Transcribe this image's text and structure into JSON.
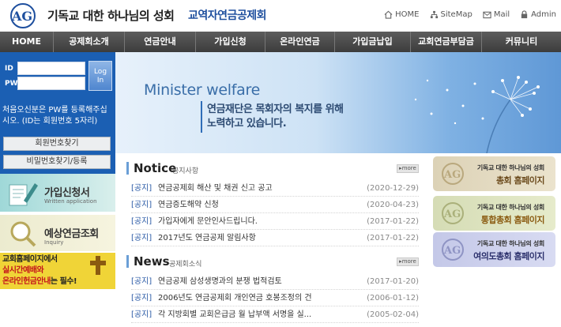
{
  "header": {
    "title": "기독교 대한 하나님의 성회",
    "subtitle": "교역자연금공제회",
    "logo_text": "AG",
    "links": [
      {
        "label": "HOME",
        "icon": "home-icon"
      },
      {
        "label": "SiteMap",
        "icon": "sitemap-icon"
      },
      {
        "label": "Mail",
        "icon": "mail-icon"
      },
      {
        "label": "Admin",
        "icon": "admin-icon"
      }
    ]
  },
  "nav": [
    "HOME",
    "공제회소개",
    "연금안내",
    "가입신청",
    "온라인연금",
    "가입금납입",
    "교회연금부담금",
    "커뮤니티"
  ],
  "login": {
    "id_label": "ID",
    "pw_label": "PW",
    "button_label_1": "Log",
    "button_label_2": "In",
    "notice": "처음오신분은 PW를 등록해주십시오. (ID는 회원번호 5자리)",
    "find_id": "회원번호찾기",
    "find_pw": "비밀번호찾기/등록"
  },
  "left_banners": {
    "apply_title": "가입신청서",
    "apply_sub": "Written application",
    "estimate_title": "예상연금조회",
    "estimate_sub": "Inquiry",
    "church_line1": "교회홈페이지에서",
    "church_line2": "실시간예배와",
    "church_line3a": "온라인헌금안내",
    "church_line3b": "는 필수!"
  },
  "hero": {
    "title": "Minister welfare",
    "line1": "연금재단은 목회자의 복지를 위해",
    "line2": "노력하고 있습니다."
  },
  "notice": {
    "title": "Notice",
    "subtitle": "공지사항",
    "more": "more",
    "items": [
      {
        "tag": "[공지]",
        "text": "연금공제회 해산 및 채권 신고 공고",
        "date": "(2020-12-29)"
      },
      {
        "tag": "[공지]",
        "text": "연금증도해약 신청",
        "date": "(2020-04-23)"
      },
      {
        "tag": "[공지]",
        "text": "가입자에게 문안인사드립니다.",
        "date": "(2017-01-22)"
      },
      {
        "tag": "[공지]",
        "text": "2017년도 연금공제 알림사항",
        "date": "(2017-01-22)"
      }
    ]
  },
  "news": {
    "title": "News",
    "subtitle": "공제회소식",
    "more": "more",
    "items": [
      {
        "tag": "[공지]",
        "text": "연금공제 삼성생명과의 분쟁 법적검토",
        "date": "(2017-01-20)"
      },
      {
        "tag": "[공지]",
        "text": "2006년도 연금공제회 개인연금 호봉조정의 건",
        "date": "(2006-01-12)"
      },
      {
        "tag": "[공지]",
        "text": "각 지방회별 교회은급금 월 납부액 서명을 실...",
        "date": "(2005-02-04)"
      }
    ]
  },
  "right_banners": [
    {
      "small": "기독교 대한 하나님의 성회",
      "big": "총회 홈페이지",
      "color": "#6b4a1c"
    },
    {
      "small": "기독교 대한 하나님의 성회",
      "big": "통합총회 홈페이지",
      "color": "#8a5a10"
    },
    {
      "small": "기독교 대한 하나님의 성회",
      "big": "여의도총회 홈페이지",
      "color": "#2a2f6b"
    }
  ]
}
